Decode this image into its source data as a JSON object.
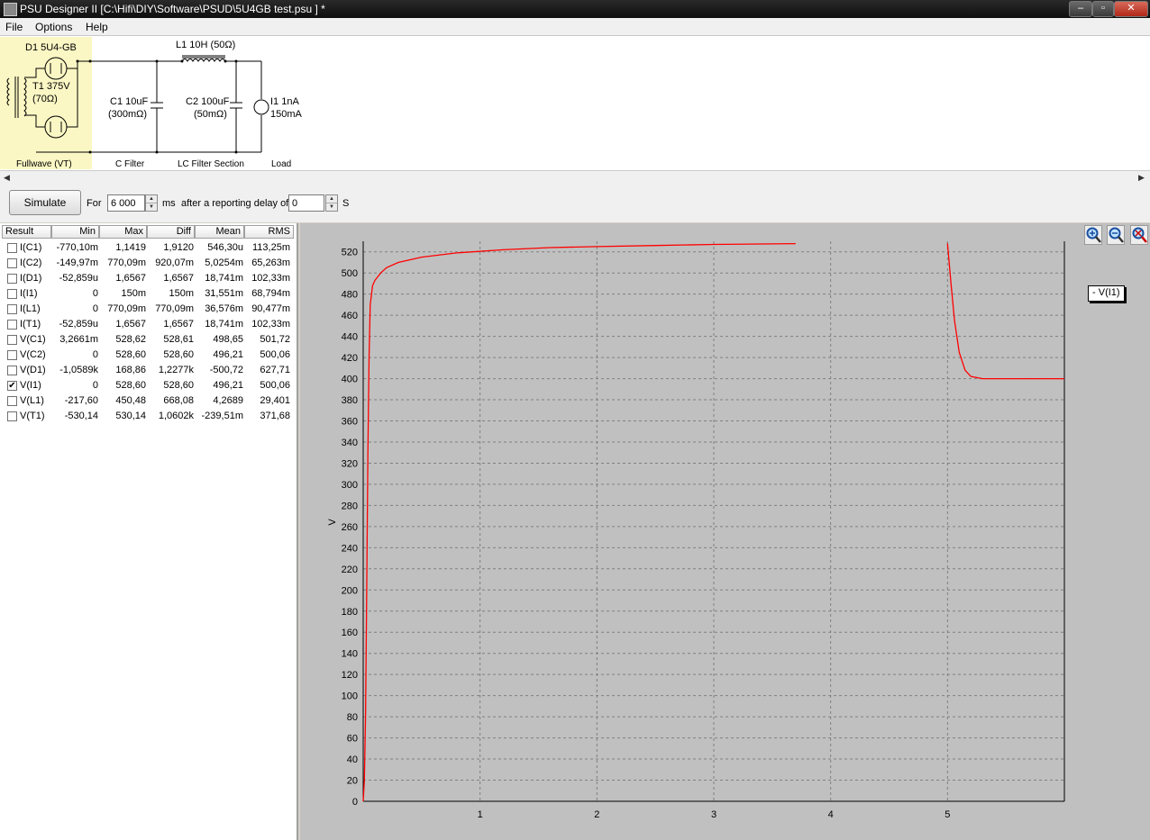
{
  "window": {
    "title": "PSU Designer II  [C:\\Hifi\\DIY\\Software\\PSUD\\5U4GB test.psu ] *"
  },
  "menu": [
    "File",
    "Options",
    "Help"
  ],
  "schematic": {
    "rectifier": "D1 5U4-GB",
    "transformer_name": "T1 375V",
    "transformer_r": "(70Ω)",
    "section_rectifier": "Fullwave (VT)",
    "c1_name": "C1 10uF",
    "c1_esr": "(300mΩ)",
    "section_cfilter": "C Filter",
    "l1": "L1 10H (50Ω)",
    "c2_name": "C2 100uF",
    "c2_esr": "(50mΩ)",
    "section_lc": "LC Filter Section",
    "load_a": "I1 1nA",
    "load_b": "150mA",
    "section_load": "Load"
  },
  "simbar": {
    "simulate_label": "Simulate",
    "for_label": "For",
    "duration": "6 000",
    "ms_label": "ms",
    "delay_label": "after a reporting delay of",
    "delay": "0",
    "s_label": "S"
  },
  "table": {
    "headers": [
      "Result",
      "Min",
      "Max",
      "Diff",
      "Mean",
      "RMS"
    ],
    "rows": [
      {
        "name": "I(C1)",
        "checked": false,
        "min": "-770,10m",
        "max": "1,1419",
        "diff": "1,9120",
        "mean": "546,30u",
        "rms": "113,25m"
      },
      {
        "name": "I(C2)",
        "checked": false,
        "min": "-149,97m",
        "max": "770,09m",
        "diff": "920,07m",
        "mean": "5,0254m",
        "rms": "65,263m"
      },
      {
        "name": "I(D1)",
        "checked": false,
        "min": "-52,859u",
        "max": "1,6567",
        "diff": "1,6567",
        "mean": "18,741m",
        "rms": "102,33m"
      },
      {
        "name": "I(I1)",
        "checked": false,
        "min": "0",
        "max": "150m",
        "diff": "150m",
        "mean": "31,551m",
        "rms": "68,794m"
      },
      {
        "name": "I(L1)",
        "checked": false,
        "min": "0",
        "max": "770,09m",
        "diff": "770,09m",
        "mean": "36,576m",
        "rms": "90,477m"
      },
      {
        "name": "I(T1)",
        "checked": false,
        "min": "-52,859u",
        "max": "1,6567",
        "diff": "1,6567",
        "mean": "18,741m",
        "rms": "102,33m"
      },
      {
        "name": "V(C1)",
        "checked": false,
        "min": "3,2661m",
        "max": "528,62",
        "diff": "528,61",
        "mean": "498,65",
        "rms": "501,72"
      },
      {
        "name": "V(C2)",
        "checked": false,
        "min": "0",
        "max": "528,60",
        "diff": "528,60",
        "mean": "496,21",
        "rms": "500,06"
      },
      {
        "name": "V(D1)",
        "checked": false,
        "min": "-1,0589k",
        "max": "168,86",
        "diff": "1,2277k",
        "mean": "-500,72",
        "rms": "627,71"
      },
      {
        "name": "V(I1)",
        "checked": true,
        "min": "0",
        "max": "528,60",
        "diff": "528,60",
        "mean": "496,21",
        "rms": "500,06"
      },
      {
        "name": "V(L1)",
        "checked": false,
        "min": "-217,60",
        "max": "450,48",
        "diff": "668,08",
        "mean": "4,2689",
        "rms": "29,401"
      },
      {
        "name": "V(T1)",
        "checked": false,
        "min": "-530,14",
        "max": "530,14",
        "diff": "1,0602k",
        "mean": "-239,51m",
        "rms": "371,68"
      }
    ]
  },
  "colors": {
    "trace": "#ff0000",
    "plot_bg": "#c0c0c0",
    "grid": "#808080",
    "schematic_highlight": "#fbf7c4"
  },
  "icons": [
    "zoom-in-icon",
    "zoom-out-icon",
    "zoom-reset-icon"
  ],
  "chart_data": {
    "type": "line",
    "ylabel": "V",
    "xlabel": "",
    "xlim": [
      0,
      6
    ],
    "ylim": [
      0,
      530
    ],
    "xticks": [
      1,
      2,
      3,
      4,
      5
    ],
    "yticks": [
      0,
      20,
      40,
      60,
      80,
      100,
      120,
      140,
      160,
      180,
      200,
      220,
      240,
      260,
      280,
      300,
      320,
      340,
      360,
      380,
      400,
      420,
      440,
      460,
      480,
      500,
      520
    ],
    "grid": true,
    "legend": "top-right",
    "series": [
      {
        "name": "V(I1)",
        "segments": [
          [
            [
              0,
              0
            ],
            [
              0.01,
              20
            ],
            [
              0.02,
              80
            ],
            [
              0.03,
              200
            ],
            [
              0.04,
              330
            ],
            [
              0.05,
              420
            ],
            [
              0.06,
              470
            ],
            [
              0.08,
              488
            ],
            [
              0.1,
              493
            ],
            [
              0.15,
              500
            ],
            [
              0.2,
              505
            ],
            [
              0.3,
              510
            ],
            [
              0.5,
              515
            ],
            [
              0.8,
              519
            ],
            [
              1.2,
              522
            ],
            [
              1.6,
              524
            ],
            [
              2.0,
              525
            ],
            [
              2.5,
              526
            ],
            [
              3.0,
              527
            ],
            [
              3.5,
              527.5
            ],
            [
              3.7,
              527.8
            ]
          ],
          [
            [
              5.0,
              528
            ],
            [
              5.03,
              490
            ],
            [
              5.06,
              455
            ],
            [
              5.1,
              425
            ],
            [
              5.15,
              408
            ],
            [
              5.2,
              402
            ],
            [
              5.3,
              400
            ],
            [
              5.6,
              400
            ],
            [
              6.0,
              400
            ]
          ]
        ]
      }
    ]
  }
}
